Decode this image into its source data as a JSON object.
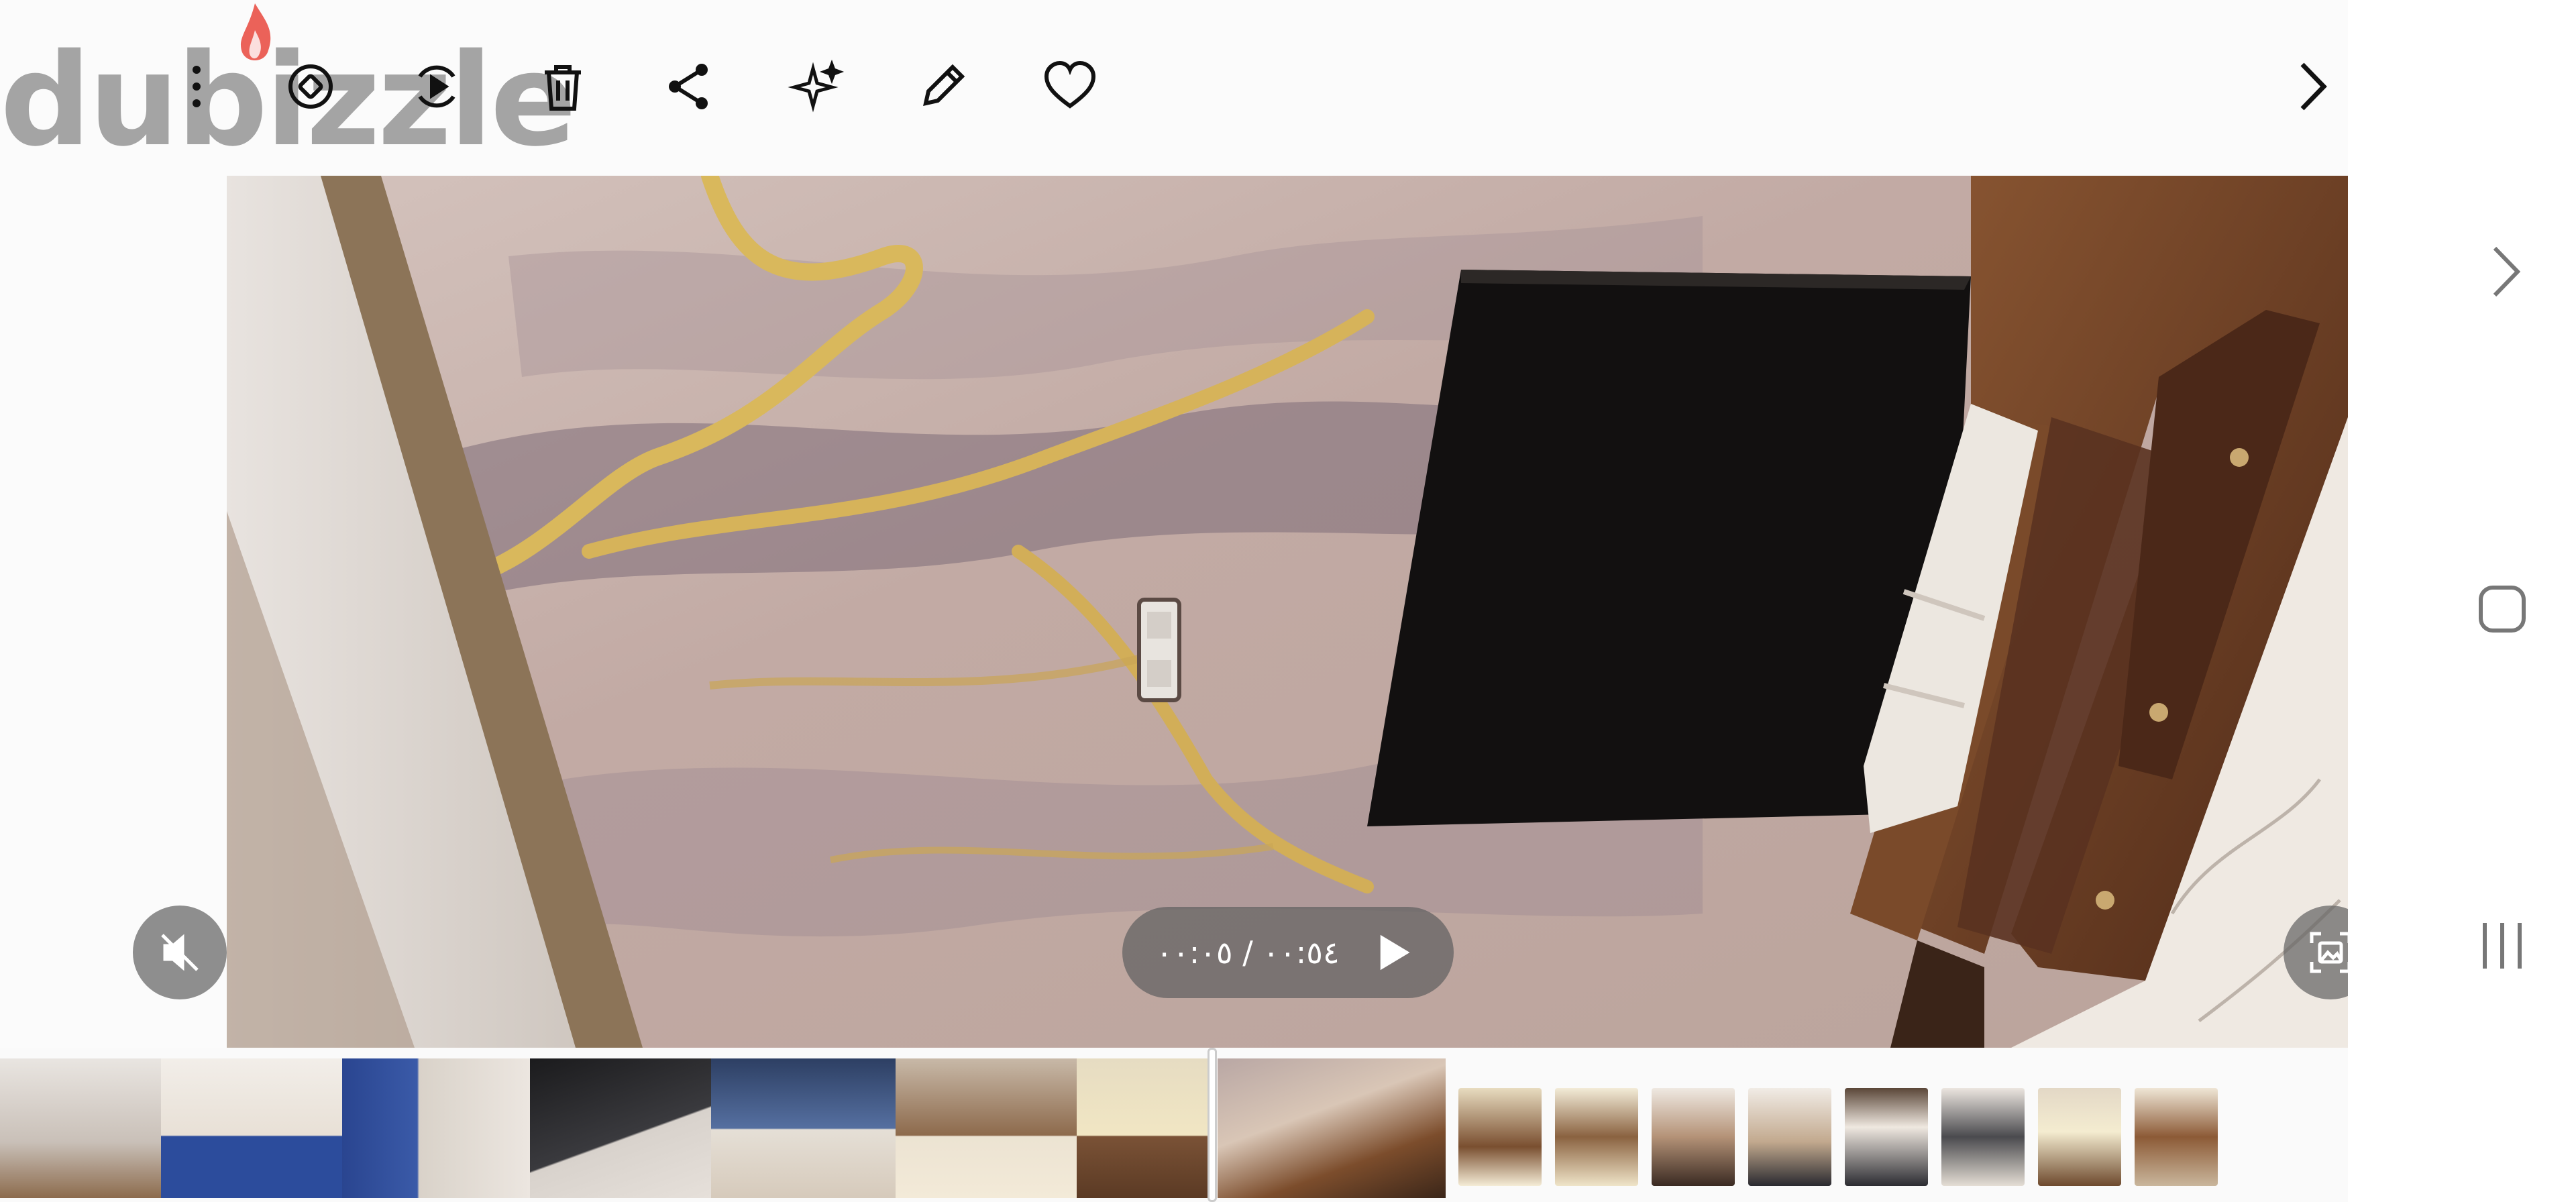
{
  "toolbar": {
    "buttons": [
      {
        "name": "more-options-icon"
      },
      {
        "name": "rotate-icon"
      },
      {
        "name": "play-speed-icon"
      },
      {
        "name": "delete-icon"
      },
      {
        "name": "share-icon"
      },
      {
        "name": "effects-icon"
      },
      {
        "name": "edit-icon"
      },
      {
        "name": "favorite-icon"
      },
      {
        "name": "next-icon"
      }
    ],
    "watermark": "dubizzle"
  },
  "player": {
    "current_time": "٠٠:٠٥",
    "separator": "/",
    "total_time": "٠٠:٥٤",
    "muted": true
  },
  "navigation_bar": {
    "buttons": [
      "back-chevron-icon",
      "home-icon",
      "recents-icon"
    ]
  },
  "colors": {
    "overlay": "#5f5f5f",
    "wall_marble": "#c9b8b0",
    "gold_vein": "#d7b65a",
    "wood": "#6b3c22"
  }
}
